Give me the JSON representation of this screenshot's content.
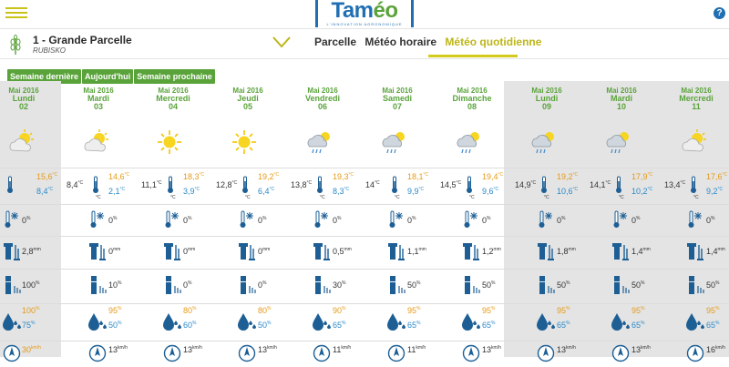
{
  "app": {
    "logo_main": "Tam",
    "logo_accent": "éo",
    "tagline": "L'INNOVATION AGRONOMIQUE",
    "help": "?"
  },
  "parcelle": {
    "title": "1 - Grande Parcelle",
    "subtitle": "RUBISKO"
  },
  "tabs": {
    "parcelle": "Parcelle",
    "horaire": "Météo horaire",
    "quotidienne": "Météo quotidienne"
  },
  "week_buttons": {
    "prev": "Semaine dernière",
    "today": "Aujourd'hui",
    "next": "Semaine prochaine"
  },
  "colors": {
    "accent": "#5aa33b",
    "tab_active": "#bdb619",
    "temp_max": "#e69a16",
    "temp_min": "#2b8ac9",
    "brand": "#1f6fb2"
  },
  "days": [
    {
      "month": "Mai 2016",
      "name": "Lundi",
      "num": "02",
      "weather_icon": "sun-cloud",
      "t_prev": "",
      "tmax": "15,6",
      "tmin": "8,4",
      "frost": "0",
      "rain": "2,8",
      "rain_unit": "mm",
      "sun": "100",
      "hum_max": "100",
      "hum_min": "75",
      "wind": "30",
      "wind_unit": "km/h"
    },
    {
      "month": "Mai 2016",
      "name": "Mardi",
      "num": "03",
      "weather_icon": "sun-cloud",
      "t_prev": "8,4",
      "tmax": "14,6",
      "tmin": "2,1",
      "frost": "0",
      "rain": "0",
      "rain_unit": "mm",
      "sun": "10",
      "hum_max": "95",
      "hum_min": "50",
      "wind": "13",
      "wind_unit": "km/h"
    },
    {
      "month": "Mai 2016",
      "name": "Mercredi",
      "num": "04",
      "weather_icon": "sun",
      "t_prev": "11,1",
      "tmax": "18,3",
      "tmin": "3,9",
      "frost": "0",
      "rain": "0",
      "rain_unit": "mm",
      "sun": "0",
      "hum_max": "80",
      "hum_min": "60",
      "wind": "13",
      "wind_unit": "km/h"
    },
    {
      "month": "Mai 2016",
      "name": "Jeudi",
      "num": "05",
      "weather_icon": "sun",
      "t_prev": "12,8",
      "tmax": "19,2",
      "tmin": "6,4",
      "frost": "0",
      "rain": "0",
      "rain_unit": "mm",
      "sun": "0",
      "hum_max": "80",
      "hum_min": "50",
      "wind": "13",
      "wind_unit": "km/h"
    },
    {
      "month": "Mai 2016",
      "name": "Vendredi",
      "num": "06",
      "weather_icon": "cloud-rain",
      "t_prev": "13,8",
      "tmax": "19,3",
      "tmin": "8,3",
      "frost": "0",
      "rain": "0,5",
      "rain_unit": "mm",
      "sun": "30",
      "hum_max": "90",
      "hum_min": "65",
      "wind": "11",
      "wind_unit": "km/h"
    },
    {
      "month": "Mai 2016",
      "name": "Samedi",
      "num": "07",
      "weather_icon": "cloud-rain",
      "t_prev": "14",
      "tmax": "18,1",
      "tmin": "9,9",
      "frost": "0",
      "rain": "1,1",
      "rain_unit": "mm",
      "sun": "50",
      "hum_max": "95",
      "hum_min": "65",
      "wind": "11",
      "wind_unit": "km/h"
    },
    {
      "month": "Mai 2016",
      "name": "Dimanche",
      "num": "08",
      "weather_icon": "cloud-rain",
      "t_prev": "14,5",
      "tmax": "19,4",
      "tmin": "9,6",
      "frost": "0",
      "rain": "1,2",
      "rain_unit": "mm",
      "sun": "50",
      "hum_max": "95",
      "hum_min": "65",
      "wind": "13",
      "wind_unit": "km/h"
    },
    {
      "month": "Mai 2016",
      "name": "Lundi",
      "num": "09",
      "weather_icon": "cloud-rain",
      "t_prev": "14,9",
      "tmax": "19,2",
      "tmin": "10,6",
      "frost": "0",
      "rain": "1,8",
      "rain_unit": "mm",
      "sun": "50",
      "hum_max": "95",
      "hum_min": "65",
      "wind": "13",
      "wind_unit": "km/h"
    },
    {
      "month": "Mai 2016",
      "name": "Mardi",
      "num": "10",
      "weather_icon": "cloud-rain",
      "t_prev": "14,1",
      "tmax": "17,9",
      "tmin": "10,2",
      "frost": "0",
      "rain": "1,4",
      "rain_unit": "mm",
      "sun": "50",
      "hum_max": "95",
      "hum_min": "65",
      "wind": "13",
      "wind_unit": "km/h"
    },
    {
      "month": "Mai 2016",
      "name": "Mercredi",
      "num": "11",
      "weather_icon": "sun-cloud",
      "t_prev": "13,4",
      "tmax": "17,6",
      "tmin": "9,2",
      "frost": "0",
      "rain": "1,4",
      "rain_unit": "mm",
      "sun": "50",
      "hum_max": "95",
      "hum_min": "65",
      "wind": "16",
      "wind_unit": "km/h"
    }
  ]
}
